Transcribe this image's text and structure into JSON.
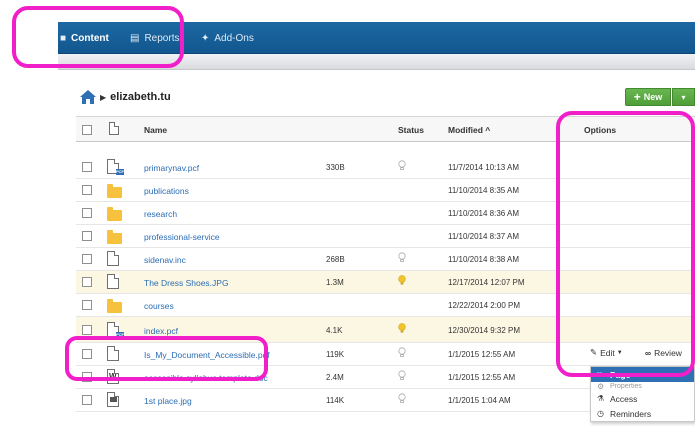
{
  "nav": {
    "tabs": [
      {
        "label": "Content",
        "icon": "folder-icon"
      },
      {
        "label": "Reports",
        "icon": "report-icon"
      },
      {
        "label": "Add-Ons",
        "icon": "puzzle-icon"
      }
    ]
  },
  "breadcrumb": {
    "path": "elizabeth.tu"
  },
  "toolbar": {
    "new_label": "New",
    "new_caret": "▾"
  },
  "table": {
    "headers": {
      "name": "Name",
      "status": "Status",
      "modified": "Modified ^",
      "options": "Options"
    },
    "rows": [
      {
        "name": "primarynav.pcf",
        "size": "330B",
        "status": "off",
        "modified": "11/7/2014 10:13 AM",
        "icon": "pcf-file-icon"
      },
      {
        "name": "publications",
        "size": "",
        "status": "",
        "modified": "11/10/2014 8:35 AM",
        "icon": "folder-icon"
      },
      {
        "name": "research",
        "size": "",
        "status": "",
        "modified": "11/10/2014 8:36 AM",
        "icon": "folder-icon"
      },
      {
        "name": "professional-service",
        "size": "",
        "status": "",
        "modified": "11/10/2014 8:37 AM",
        "icon": "folder-icon"
      },
      {
        "name": "sidenav.inc",
        "size": "268B",
        "status": "off",
        "modified": "11/10/2014 8:38 AM",
        "icon": "file-icon"
      },
      {
        "name": "The Dress Shoes.JPG",
        "size": "1.3M",
        "status": "on",
        "modified": "12/17/2014 12:07 PM",
        "icon": "file-icon"
      },
      {
        "name": "courses",
        "size": "",
        "status": "",
        "modified": "12/22/2014 2:00 PM",
        "icon": "folder-icon"
      },
      {
        "name": "index.pcf",
        "size": "4.1K",
        "status": "on",
        "modified": "12/30/2014 9:32 PM",
        "icon": "pcf-file-icon"
      },
      {
        "name": "Is_My_Document_Accessible.pdf",
        "size": "119K",
        "status": "off",
        "modified": "1/1/2015 12:55 AM",
        "icon": "pdf-file-icon"
      },
      {
        "name": "accessible syllabus template.doc",
        "size": "2.4M",
        "status": "off",
        "modified": "1/1/2015 12:55 AM",
        "icon": "word-file-icon"
      },
      {
        "name": "1st place.jpg",
        "size": "114K",
        "status": "off",
        "modified": "1/1/2015 1:04 AM",
        "icon": "image-file-icon"
      }
    ]
  },
  "options": {
    "edit_label": "Edit",
    "review_label": "Review",
    "menu": [
      {
        "label": "Page",
        "icon": "page-icon",
        "active": true
      },
      {
        "label": "Properties",
        "icon": "gear-icon",
        "active": false
      },
      {
        "label": "Access",
        "icon": "key-icon",
        "active": false
      },
      {
        "label": "Reminders",
        "icon": "clock-icon",
        "active": false
      }
    ]
  },
  "colors": {
    "nav_bg": "#1d68a3",
    "new_button": "#5aab42",
    "link": "#2a6db5",
    "highlight_row": "#fcf7e3",
    "annotation": "#f01fc9",
    "bulb_on": "#f3c22d"
  }
}
